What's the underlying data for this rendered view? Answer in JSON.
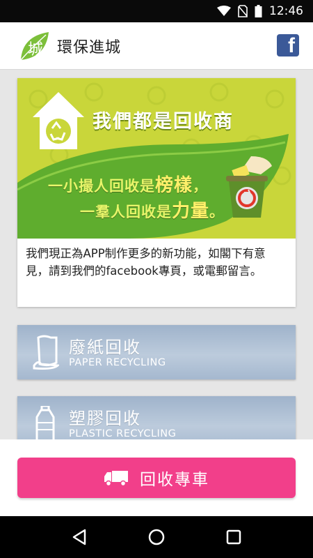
{
  "status_bar": {
    "time": "12:46",
    "icons": [
      "wifi-icon",
      "no-sim-icon",
      "battery-icon"
    ]
  },
  "app_bar": {
    "title": "環保進城",
    "logo_glyph": "城",
    "facebook_label": "f"
  },
  "banner": {
    "headline": "我們都是回收商",
    "line1_prefix": "一小撮人回收是",
    "line1_emph": "榜樣",
    "line1_suffix": "，",
    "line2_prefix": "一羣人回收是",
    "line2_emph": "力量",
    "line2_suffix": "。",
    "description": "我們現正為APP制作更多的新功能，如閣下有意見，請到我們的facebook專頁，或電郵留言。"
  },
  "categories": [
    {
      "zh": "廢紙回收",
      "en": "PAPER RECYCLING",
      "icon": "paper-icon"
    },
    {
      "zh": "塑膠回收",
      "en": "PLASTIC RECYCLING",
      "icon": "plastic-bottle-icon"
    }
  ],
  "action_button": {
    "label": "回收專車",
    "icon": "truck-icon"
  },
  "colors": {
    "accent_pink": "#f23f8a",
    "banner_green": "#c9d63a",
    "facebook_blue": "#3b5998"
  }
}
